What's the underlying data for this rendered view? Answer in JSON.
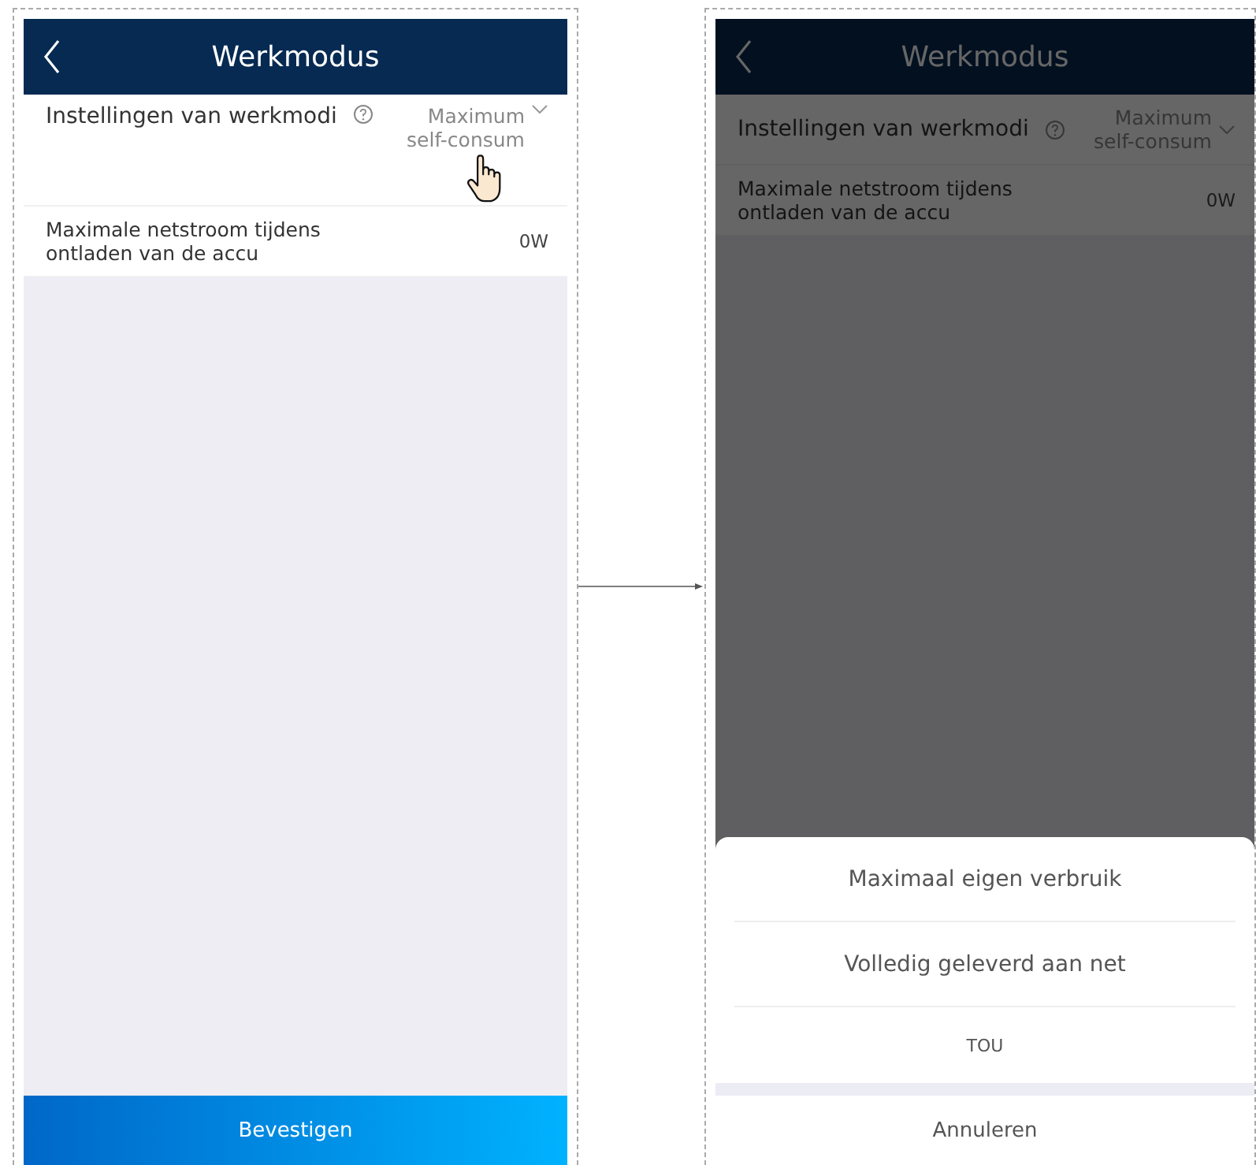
{
  "screens": [
    {
      "dimmed": false,
      "header": {
        "title": "Werkmodus"
      },
      "rows": [
        {
          "kind": "select",
          "label": "Instellingen van werkmodi",
          "value": "Maximum self-consum",
          "tapped": true
        },
        {
          "kind": "value",
          "label": "Maximale netstroom tijdens ontladen van de accu",
          "value": "0W",
          "tapped": false
        }
      ],
      "confirm_button": "Bevestigen"
    },
    {
      "dimmed": true,
      "header": {
        "title": "Werkmodus"
      },
      "rows": [
        {
          "kind": "select",
          "label": "Instellingen van werkmodi",
          "value": "Maximum self-consum",
          "tapped": false
        },
        {
          "kind": "value",
          "label": "Maximale netstroom tijdens ontladen van de accu",
          "value": "0W",
          "tapped": false
        }
      ],
      "action_sheet": {
        "options": [
          "Maximaal eigen verbruik",
          "Volledig geleverd aan net",
          "TOU"
        ],
        "cancel": "Annuleren"
      }
    }
  ]
}
